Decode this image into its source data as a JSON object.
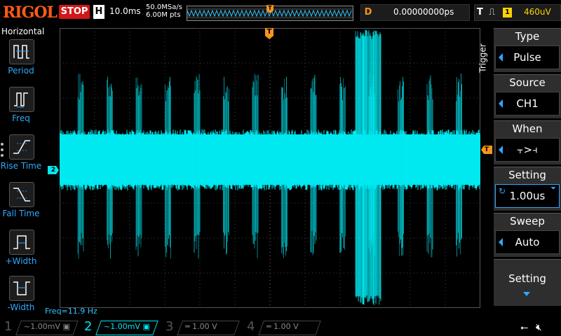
{
  "top": {
    "logo": "RIGOL",
    "run_state": "STOP",
    "timebase_badge": "H",
    "timebase": "10.0ms",
    "sample_rate": "50.0MSa/s",
    "memory_depth": "6.00M pts",
    "delay_badge": "D",
    "delay": "0.00000000ps",
    "trigger_badge": "T",
    "trigger_edge": "⎍",
    "trigger_source_badge": "1",
    "trigger_level": "460uV"
  },
  "left_menu": {
    "title": "Horizontal",
    "items": [
      {
        "label": "Period",
        "icon": "period-icon"
      },
      {
        "label": "Freq",
        "icon": "freq-icon"
      },
      {
        "label": "Rise Time",
        "icon": "rise-time-icon"
      },
      {
        "label": "Fall Time",
        "icon": "fall-time-icon"
      },
      {
        "label": "+Width",
        "icon": "pos-width-icon"
      },
      {
        "label": "-Width",
        "icon": "neg-width-icon"
      }
    ]
  },
  "screen": {
    "frequency_readout": "Freq=11.9 Hz",
    "channel_marker": "2",
    "trace_color": "#00e8f0",
    "trigger_color": "#f7941d",
    "burst_count": 14
  },
  "right_menu": {
    "tab_label": "Trigger",
    "type": {
      "title": "Type",
      "value": "Pulse"
    },
    "source": {
      "title": "Source",
      "value": "CH1"
    },
    "when": {
      "title": "When",
      "value": "⫟>⫞"
    },
    "setting": {
      "title": "Setting",
      "value": "1.00us"
    },
    "sweep": {
      "title": "Sweep",
      "value": "Auto"
    },
    "more": {
      "title": "Setting"
    }
  },
  "bottom": {
    "channels": [
      {
        "num": "1",
        "text": "~1.00mV ▣",
        "active": false
      },
      {
        "num": "2",
        "text": "~1.00mV ▣",
        "active": true
      },
      {
        "num": "3",
        "text": "═   1.00 V",
        "active": false
      },
      {
        "num": "4",
        "text": "═   1.00 V",
        "active": false
      }
    ],
    "usb_icon": "usb-icon",
    "speaker_icon": "speaker-muted-icon"
  }
}
